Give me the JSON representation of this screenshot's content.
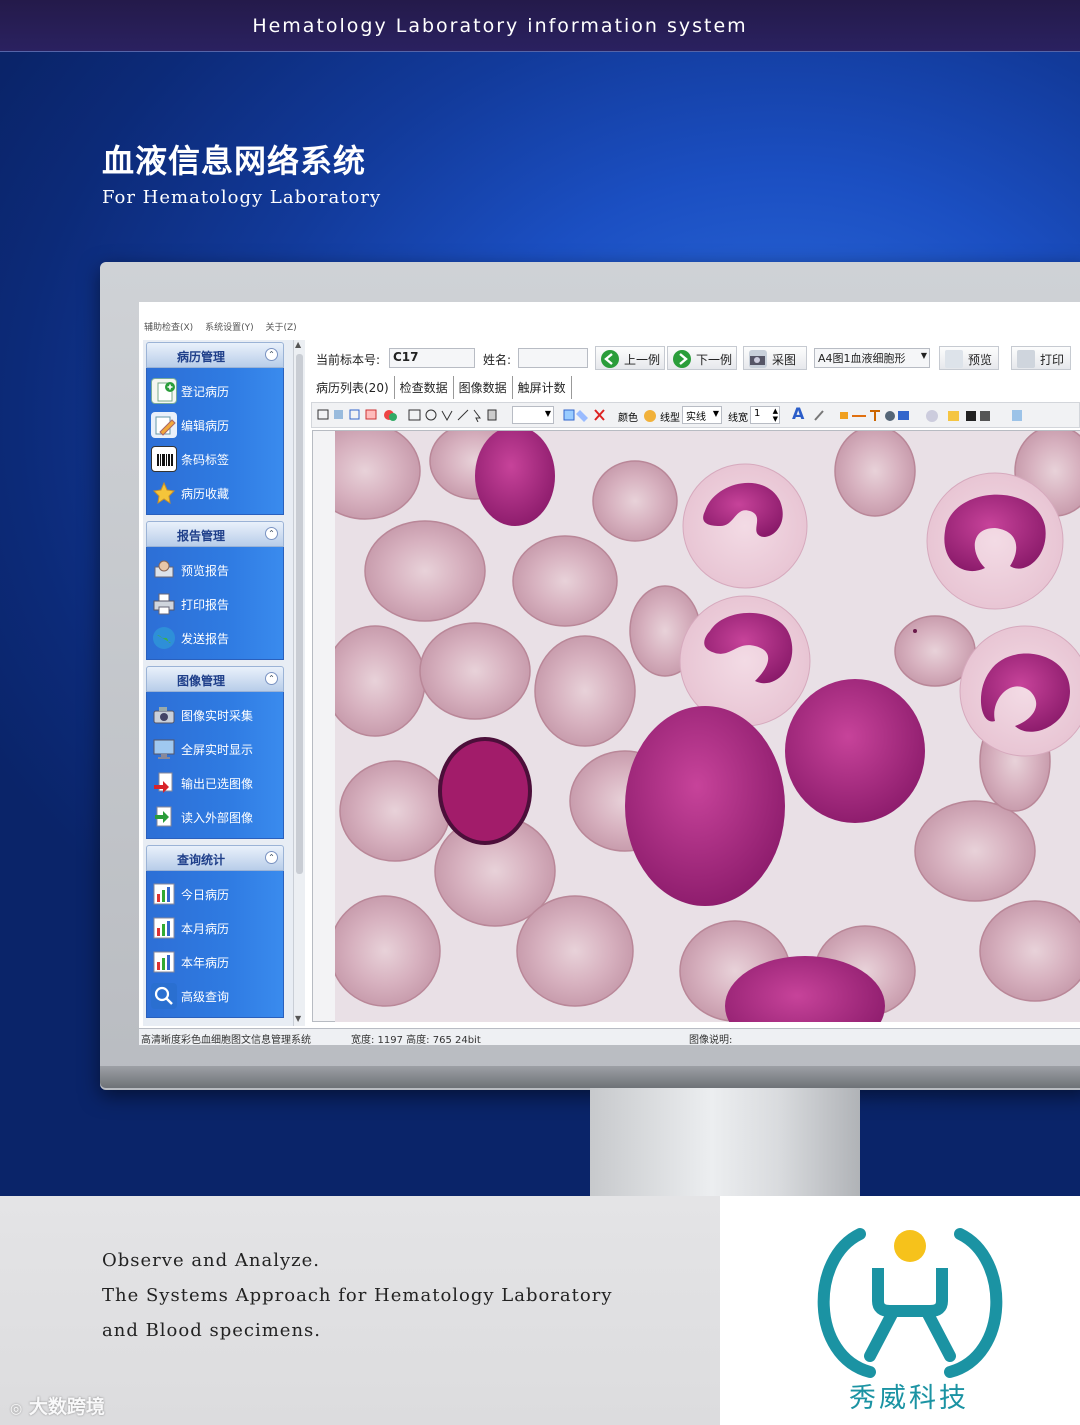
{
  "header": {
    "system_title": "Hematology Laboratory information system",
    "cn_title": "血液信息网络系统",
    "en_subtitle": "For Hematology Laboratory"
  },
  "app": {
    "menu": [
      "辅助检查(X)",
      "系统设置(Y)",
      "关于(Z)"
    ],
    "sidebar": {
      "panels": [
        {
          "title": "病历管理",
          "items": [
            "登记病历",
            "编辑病历",
            "条码标签",
            "病历收藏"
          ]
        },
        {
          "title": "报告管理",
          "items": [
            "预览报告",
            "打印报告",
            "发送报告"
          ]
        },
        {
          "title": "图像管理",
          "items": [
            "图像实时采集",
            "全屏实时显示",
            "输出已选图像",
            "读入外部图像"
          ]
        },
        {
          "title": "查询统计",
          "items": [
            "今日病历",
            "本月病历",
            "本年病历",
            "高级查询"
          ]
        }
      ]
    },
    "toolbar": {
      "specimen_label": "当前标本号:",
      "specimen_value": "C17",
      "name_label": "姓名:",
      "name_value": "",
      "prev_button": "上一例",
      "next_button": "下一例",
      "capture_button": "采图",
      "template_select": "A4图1血液细胞形",
      "preview_button": "预览",
      "print_button": "打印"
    },
    "tabs": [
      "病历列表(20)",
      "检查数据",
      "图像数据",
      "触屏计数"
    ],
    "drawing_toolbar": {
      "color_label": "颜色",
      "linetype_label": "线型",
      "linetype_value": "实线",
      "linewidth_label": "线宽",
      "linewidth_value": "1",
      "font_icon": "A"
    },
    "statusbar": {
      "app_name": "高清晰度彩色血细胞图文信息管理系统",
      "image_info": "宽度: 1197 高度: 765 24bit",
      "image_note": "图像说明:"
    }
  },
  "footer": {
    "tagline_1": "Observe and Analyze.",
    "tagline_2": "The Systems Approach for Hematology Laboratory",
    "tagline_3": "and Blood specimens.",
    "brand_cn": "秀威科技",
    "watermark": "大数跨境"
  },
  "colors": {
    "brand_teal": "#1b93a3",
    "logo_sun": "#f6c21b",
    "sidebar_blue": "#2f7be2",
    "hero_blue": "#1b4fc2"
  }
}
